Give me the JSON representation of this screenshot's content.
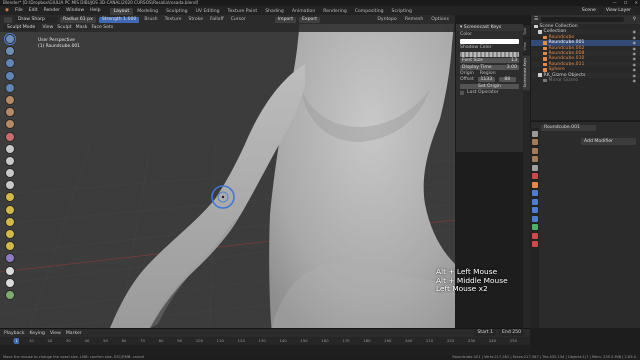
{
  "window": {
    "title": "Blender* [D:\\Dropbox\\GIULIA PC MIS DIBUJOS 3D-CANAL\\2020 CURSOS\\Rosalia\\rosada.blend]",
    "controls": [
      "—",
      "☐",
      "✕"
    ]
  },
  "menubar": {
    "items": [
      "File",
      "Edit",
      "Render",
      "Window",
      "Help"
    ],
    "workspaces": [
      "Layout",
      "Modeling",
      "Sculpting",
      "UV Editing",
      "Texture Paint",
      "Shading",
      "Animation",
      "Rendering",
      "Compositing",
      "Scripting"
    ],
    "active_workspace": "Layout",
    "scene": "Scene",
    "view_layer": "View Layer"
  },
  "tool_header": {
    "brush": "Draw Sharp",
    "radius_label": "Radius",
    "radius_value": "61 px",
    "strength_label": "Strength",
    "strength_value": "1.000",
    "menus": [
      "Brush",
      "Texture",
      "Stroke",
      "Falloff",
      "Cursor"
    ],
    "mode_buttons": [
      "Import",
      "Export"
    ],
    "options": [
      "Dyntopo",
      "Remesh",
      "Options"
    ]
  },
  "viewport_header": {
    "mode": "Sculpt Mode",
    "menus": [
      "View",
      "Sculpt",
      "Mask",
      "Face Sets"
    ]
  },
  "viewport": {
    "view_name": "User Perspective",
    "object_name": "(1) Roundcube.001",
    "keycast": [
      "Alt + Left Mouse",
      "Alt + Middle Mouse",
      "Left Mouse x2"
    ]
  },
  "npanel": {
    "header": "Screencast Keys",
    "color_label": "Color",
    "shadow_color_label": "Shadow Color",
    "font_size_label": "Font Size",
    "font_size_value": "13",
    "display_time_label": "Display Time",
    "display_time_value": "3.00",
    "origin_label": "Origin",
    "origin_value": "Region",
    "offset_label": "Offset",
    "offset_x": "1133",
    "offset_y": "88",
    "set_origin": "Set Origin",
    "last_operator": "Last Operator",
    "tabs": [
      "Tool",
      "View",
      "Screencast Keys"
    ]
  },
  "outliner": {
    "rows": [
      {
        "label": "Scene Collection",
        "color": "#cfcfcf",
        "sel": false
      },
      {
        "label": "Collection",
        "color": "#cfcfcf",
        "sel": false
      },
      {
        "label": "Roundcube",
        "color": "#e38a4a",
        "sel": false
      },
      {
        "label": "Roundcube.001",
        "color": "#e38a4a",
        "sel": true
      },
      {
        "label": "Roundcube.002",
        "color": "#e38a4a",
        "sel": false
      },
      {
        "label": "Roundcube.008",
        "color": "#e38a4a",
        "sel": false
      },
      {
        "label": "Roundcube.010",
        "color": "#e38a4a",
        "sel": false
      },
      {
        "label": "Roundcube.011",
        "color": "#e38a4a",
        "sel": false
      },
      {
        "label": "Sphere",
        "color": "#e38a4a",
        "sel": false
      },
      {
        "label": "RK_Gizmo Objects",
        "color": "#cfcfcf",
        "sel": false
      },
      {
        "label": "Mirror Gizmo",
        "color": "#7a7a7a",
        "sel": false
      }
    ]
  },
  "properties": {
    "object_name": "Roundcube.001",
    "add_modifier": "Add Modifier"
  },
  "timeline": {
    "menus": [
      "Playback",
      "Keying",
      "View",
      "Marker"
    ],
    "current_frame": "1",
    "ticks": [
      "0",
      "10",
      "20",
      "30",
      "40",
      "50",
      "60",
      "70",
      "80",
      "90",
      "100",
      "110",
      "120",
      "130",
      "140",
      "150",
      "160",
      "170",
      "180",
      "190",
      "200",
      "210",
      "220",
      "230",
      "240",
      "250"
    ],
    "start_label": "Start",
    "start": "1",
    "end_label": "End",
    "end": "250"
  },
  "status": {
    "left": "Move the mouse to change the voxel size. LMB: confirm size, ESC/RMB: cancel",
    "right": "Roundcube.001 | Verts:217,561 | Faces:217,567 | Tris:435,134 | Objects:1/7 | Mem: 235.5 MiB | 2.83.0"
  },
  "colors": {
    "accent": "#3f68b5",
    "viewport_bg": "#3c3c3c",
    "mesh": "#b8b8b8"
  }
}
